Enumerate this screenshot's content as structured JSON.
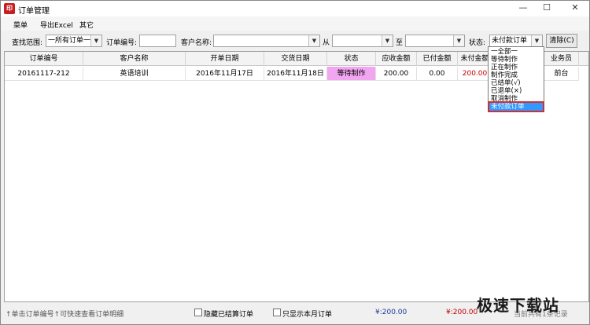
{
  "window": {
    "title": "订单管理",
    "icon": "app-logo-icon",
    "controls": [
      "—",
      "☐",
      "✕"
    ]
  },
  "menu": {
    "items": [
      "菜单",
      "导出Excel",
      "其它"
    ]
  },
  "filters": {
    "range_label": "查找范围:",
    "range_value": "一所有订单一",
    "order_no_label": "订单编号:",
    "order_no_value": "",
    "customer_label": "客户名称:",
    "customer_value": "",
    "from_label": "从",
    "from_value": "",
    "to_label": "至",
    "to_value": "",
    "status_label": "状态:",
    "status_value": "未付款订单",
    "clear_button": "清除(C)"
  },
  "table": {
    "columns": [
      "订单编号",
      "客户名称",
      "开单日期",
      "交货日期",
      "状态",
      "应收金额",
      "已付金额",
      "未付金额",
      "业务员"
    ],
    "rows": [
      [
        "20161117-212",
        "英语培训",
        "2016年11月17日",
        "2016年11月18日",
        "等待制作",
        "200.00",
        "0.00",
        "200.00",
        "前台"
      ]
    ]
  },
  "status_dropdown": {
    "options": [
      "一全部一",
      "等待制作",
      "正在制作",
      "制作完成",
      "已结单(√)",
      "已退单(×)",
      "取消制作",
      "未付款订单"
    ],
    "selected": "未付款订单"
  },
  "statusbar": {
    "hint": "↑单击订单编号↑可快速查看订单明细",
    "hide_settled_label": "隐藏已结算订单",
    "current_month_label": "只显示本月订单",
    "total_receivable": "¥:200.00",
    "total_unpaid": "¥:200.00",
    "summary": "当前共有1条记录"
  },
  "watermark": "极速下载站",
  "colors": {
    "status_highlight": "#f2a6f2",
    "unpaid_red": "#c00000",
    "selection_blue": "#3399ff"
  }
}
